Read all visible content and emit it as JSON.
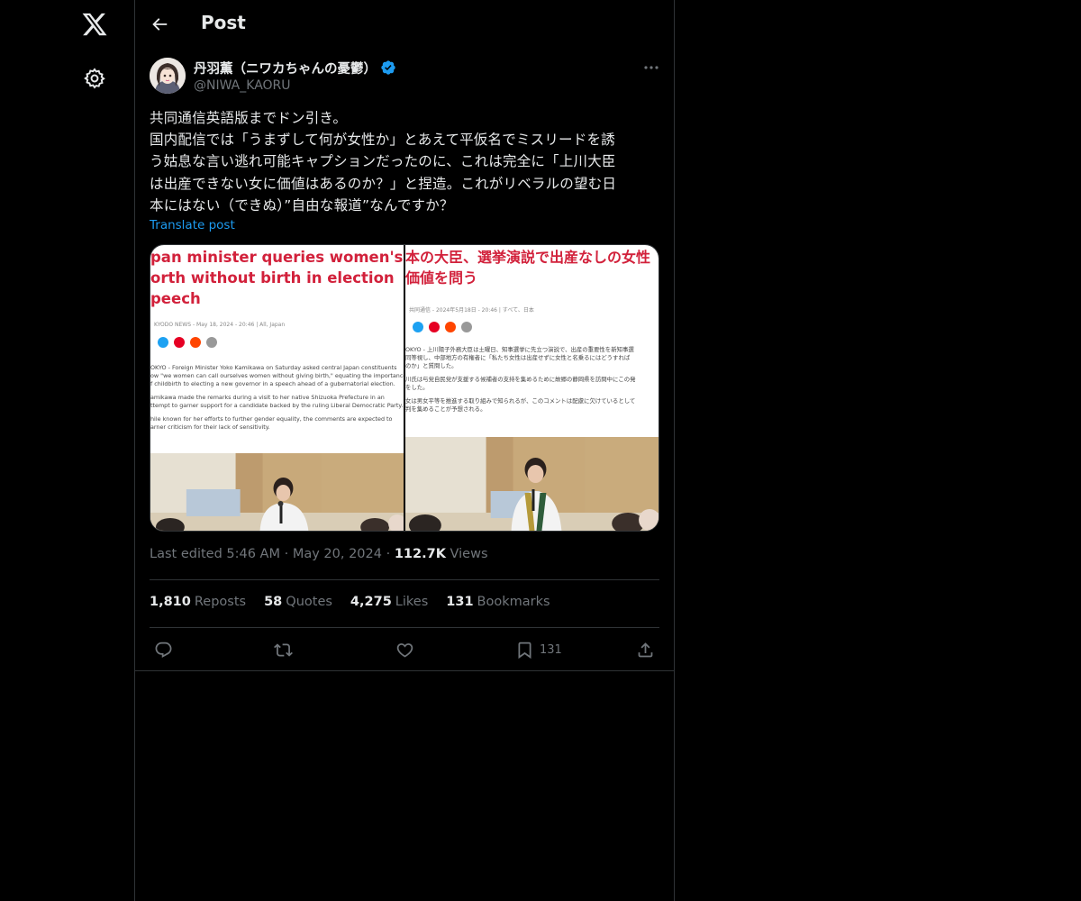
{
  "app": {
    "logo_icon": "x-logo-icon",
    "settings_icon": "gear-icon"
  },
  "header": {
    "title": "Post",
    "back_icon": "arrow-left-icon"
  },
  "post": {
    "author": {
      "name": "丹羽薫（ニワカちゃんの憂鬱）",
      "handle": "@NIWA_KAORU",
      "verified": true
    },
    "text_lines": [
      "共同通信英語版までドン引き。",
      "国内配信では「うまずして何が女性か」とあえて平仮名でミスリードを誘",
      "う姑息な言い逃れ可能キャプションだったのに、これは完全に「上川大臣",
      "は出産できない女に価値はあるのか？」と捏造。これがリベラルの望む日",
      "本にはない（できぬ）”自由な報道”なんですか？"
    ],
    "translate_label": "Translate post",
    "media": [
      {
        "headline_lines": [
          "pan minister queries women's",
          "orth without birth in election",
          "peech"
        ],
        "meta": "KYODO NEWS - May 18, 2024 - 20:46 | All, Japan",
        "body": [
          "OKYO - Foreign Minister Yoko Kamikawa on Saturday asked central Japan constituents",
          "ow \"we women can call ourselves women without giving birth,\" equating the importance",
          "f childbirth to electing a new governor in a speech ahead of a gubernatorial election.",
          "amikawa made the remarks during a visit to her native Shizuoka Prefecture in an",
          "ttempt to garner support for a candidate backed by the ruling Liberal Democratic Party.",
          "hile known for her efforts to further gender equality, the comments are expected to",
          "arner criticism for their lack of sensitivity."
        ]
      },
      {
        "headline_lines": [
          "本の大臣、選挙演説で出産なしの女性",
          "価値を問う"
        ],
        "meta": "共同通信 - 2024年5月18日 - 20:46 | すべて、日本",
        "body": [
          "OKYO - 上川陽子外務大臣は土曜日、知事選挙に先立つ演説で、出産の重要性を新知事選",
          "同等視し、中部地方の有権者に「私たち女性は出産せずに女性と名乗るにはどうすれば",
          "のか」と質問した。",
          "川氏は与党自民党が支援する候補者の支持を集めるために故郷の静岡県を訪問中にこの発",
          "をした。",
          "女は男女平等を推進する取り組みで知られるが、このコメントは配慮に欠けているとして",
          "判を集めることが予想される。"
        ]
      }
    ],
    "edited": {
      "prefix": "Last edited 5:46 AM",
      "date": "May 20, 2024",
      "views_count": "112.7K",
      "views_label": "Views",
      "sep": "·"
    },
    "stats": [
      {
        "count": "1,810",
        "label": "Reposts"
      },
      {
        "count": "58",
        "label": "Quotes"
      },
      {
        "count": "4,275",
        "label": "Likes"
      },
      {
        "count": "131",
        "label": "Bookmarks"
      }
    ],
    "actions": {
      "reply_icon": "reply-icon",
      "repost_icon": "repost-icon",
      "like_icon": "heart-icon",
      "bookmark_icon": "bookmark-icon",
      "bookmark_count": "131",
      "share_icon": "share-icon"
    }
  },
  "colors": {
    "accent": "#1d9bf0",
    "headline_red": "#d2213b",
    "muted": "#71767b"
  }
}
